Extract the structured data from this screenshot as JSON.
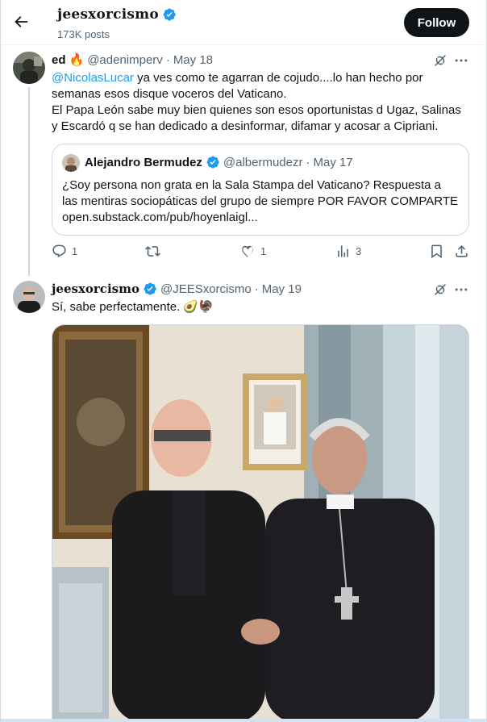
{
  "header": {
    "profile_name": "jeesxorcismo",
    "post_count": "173K posts",
    "follow_label": "Follow"
  },
  "reply_tweet": {
    "name": "ed",
    "name_emoji": "🔥",
    "handle": "@adenimperv",
    "date": "May 18",
    "mention": "@NicolasLucar",
    "text_line1_rest": " ya ves como te agarran de cojudo....lo han hecho por",
    "text_line2": "semanas esos disque voceros del Vaticano.",
    "text_line3": "El Papa León sabe muy bien quienes son esos oportunistas d Ugaz, Salinas",
    "text_line4": "y Escardó q se han dedicado a desinformar, difamar y acosar a Cipriani.",
    "quote": {
      "name": "Alejandro Bermudez",
      "handle": "@albermudezr",
      "date": "May 17",
      "line1": "¿Soy persona non grata en la Sala Stampa del Vaticano? Respuesta a",
      "line2": "las mentiras sociopáticas del grupo de siempre POR FAVOR COMPARTE",
      "line3": "open.substack.com/pub/hoyenlaigl..."
    },
    "actions": {
      "reply_count": "1",
      "repost_count": "",
      "like_count": "1",
      "views_count": "3"
    }
  },
  "main_tweet": {
    "name": "jeesxorcismo",
    "handle": "@JEESxorcismo",
    "date": "May 19",
    "text": "Sí, sabe perfectamente. 🥑🦃"
  },
  "separator": "·",
  "colors": {
    "accent": "#1d9bf0",
    "text": "#0f1419",
    "secondary": "#536471",
    "border": "#cfd9de",
    "follow_bg": "#0f1419"
  },
  "icons": {
    "back": "arrow-left-icon",
    "verified": "verified-badge-icon",
    "grok": "grok-icon",
    "more": "more-icon",
    "reply": "reply-icon",
    "repost": "repost-icon",
    "like": "like-icon",
    "views": "views-icon",
    "bookmark": "bookmark-icon",
    "share": "share-icon"
  }
}
